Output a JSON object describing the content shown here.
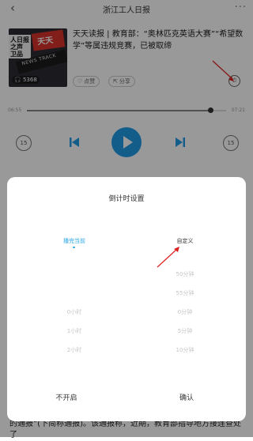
{
  "header": {
    "title": "浙江工人日报",
    "back_icon": "chevron-left-icon",
    "more_icon": "more-dots-icon",
    "more": "···"
  },
  "article": {
    "cover_text_1": "人日报\n之声\n卫品",
    "cover_text_2": "天天",
    "cover_text_3": "NEWS TRACK",
    "play_count": "5368",
    "title": "天天读报 | 教育部：“奥林匹克英语大赛”“希望数学”等属违规竞赛，已被取缔",
    "like_label": "点赞",
    "share_label": "分享",
    "timer_glyph": "⏱"
  },
  "player": {
    "time_current": "06:55",
    "time_total": "07:21",
    "progress": 0.92,
    "rewind_label": "15",
    "forward_label": "15",
    "accent": "#1e9ce6"
  },
  "background_text": "的通报”(下简称通报)。该通报称，近期，教育部指导地方接连查处了",
  "dialog": {
    "title": "倒计时设置",
    "left_options": [
      {
        "label": "播完当前",
        "state": "selected"
      },
      {
        "label": "0小时",
        "state": "faded"
      },
      {
        "label": "1小时",
        "state": "faded"
      },
      {
        "label": "2小时",
        "state": "faded"
      }
    ],
    "right_options": [
      {
        "label": "自定义",
        "state": "strong"
      },
      {
        "label": "50分钟",
        "state": "faded"
      },
      {
        "label": "55分钟",
        "state": "faded"
      },
      {
        "label": "0分钟",
        "state": "faded"
      },
      {
        "label": "5分钟",
        "state": "faded"
      },
      {
        "label": "10分钟",
        "state": "faded"
      }
    ],
    "cancel_label": "不开启",
    "confirm_label": "确认",
    "selected_color": "#2ba7e8"
  }
}
